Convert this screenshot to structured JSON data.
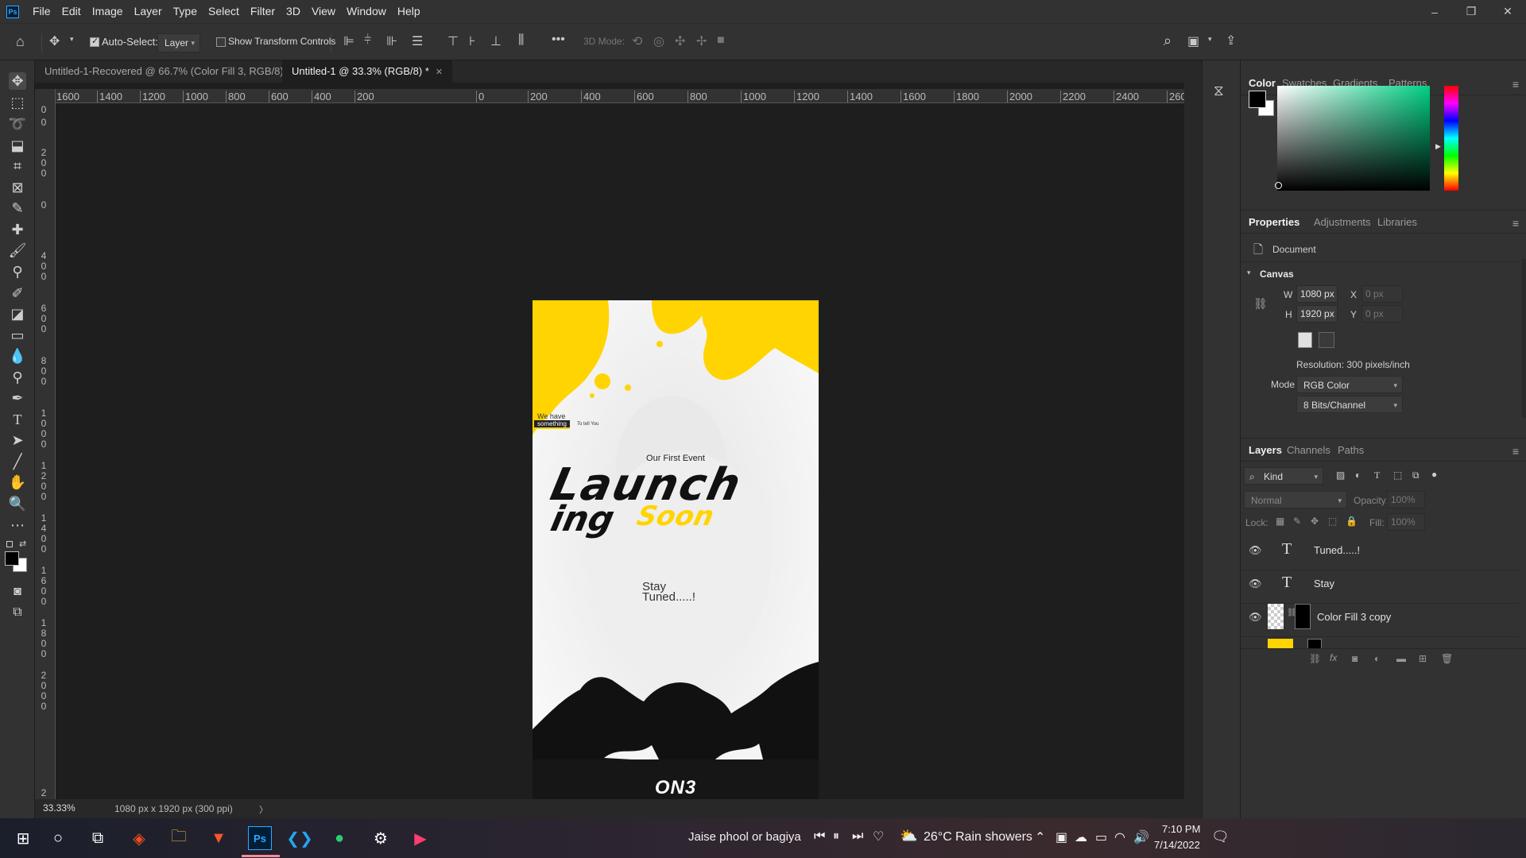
{
  "menu": {
    "logo": "Ps",
    "items": [
      "File",
      "Edit",
      "Image",
      "Layer",
      "Type",
      "Select",
      "Filter",
      "3D",
      "View",
      "Window",
      "Help"
    ]
  },
  "window_controls": {
    "minimize": "–",
    "restore": "❐",
    "close": "✕"
  },
  "options_bar": {
    "auto_select_label": "Auto-Select:",
    "auto_select_checked": true,
    "auto_select_target": "Layer",
    "transform_controls_label": "Show Transform Controls",
    "transform_controls_checked": false,
    "more": "•••",
    "mode_3d_label": "3D Mode:"
  },
  "tabs": [
    {
      "label": "Untitled-1-Recovered @ 66.7% (Color Fill 3, RGB/8) *",
      "active": false
    },
    {
      "label": "Untitled-1 @ 33.3% (RGB/8) *",
      "active": true
    }
  ],
  "ruler_h": [
    "1600",
    "1400",
    "1200",
    "1000",
    "800",
    "600",
    "400",
    "200",
    "0",
    "200",
    "400",
    "600",
    "800",
    "1000",
    "1200",
    "1400",
    "1600",
    "1800",
    "2000",
    "2200",
    "2400",
    "260"
  ],
  "ruler_v": [
    "0",
    "0",
    "200",
    "0",
    "400",
    "600",
    "800",
    "1000",
    "1200",
    "1400",
    "1600",
    "1800",
    "2000",
    "2"
  ],
  "artwork": {
    "tagline_top": "We have",
    "tagline_highlight": "something",
    "tagline_small": "To tell You",
    "event": "Our First Event",
    "headline_1": "Launch",
    "headline_2": "ing",
    "headline_3": "Soon",
    "footer_1": "Stay",
    "footer_2": "Tuned.....!",
    "logo": "ON3",
    "accent": "#ffd400"
  },
  "status": {
    "zoom": "33.33%",
    "info": "1080 px x 1920 px (300 ppi)",
    "arrow": "〉"
  },
  "color_panel": {
    "tabs": [
      "Color",
      "Swatches",
      "Gradients",
      "Patterns"
    ],
    "active": "Color",
    "hue": "#00d084"
  },
  "properties_panel": {
    "tabs": [
      "Properties",
      "Adjustments",
      "Libraries"
    ],
    "active": "Properties",
    "doc_label": "Document",
    "section": "Canvas",
    "w_label": "W",
    "w_value": "1080 px",
    "h_label": "H",
    "h_value": "1920 px",
    "x_label": "X",
    "x_value": "0 px",
    "y_label": "Y",
    "y_value": "0 px",
    "resolution": "Resolution: 300 pixels/inch",
    "mode_label": "Mode",
    "mode_value": "RGB Color",
    "bits_value": "8 Bits/Channel"
  },
  "layers_panel": {
    "tabs": [
      "Layers",
      "Channels",
      "Paths"
    ],
    "active": "Layers",
    "filter_kind": "Kind",
    "blend_mode": "Normal",
    "opacity_label": "Opacity:",
    "opacity_value": "100%",
    "lock_label": "Lock:",
    "fill_label": "Fill:",
    "fill_value": "100%",
    "layers": [
      {
        "name": "Tuned.....!",
        "type": "text"
      },
      {
        "name": "Stay",
        "type": "text"
      },
      {
        "name": "Color Fill 3 copy",
        "type": "fill"
      }
    ]
  },
  "taskbar": {
    "media_title": "Jaise phool or bagiya",
    "weather_temp": "26°C",
    "weather_text": "Rain showers",
    "time": "7:10 PM",
    "date": "7/14/2022"
  }
}
